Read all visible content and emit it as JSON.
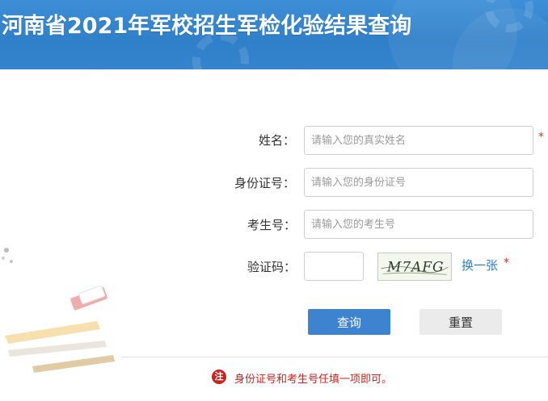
{
  "header": {
    "title": "河南省2021年军校招生军检化验结果查询"
  },
  "form": {
    "name": {
      "label": "姓名：",
      "placeholder": "请输入您的真实姓名",
      "required_mark": "*"
    },
    "id_number": {
      "label": "身份证号：",
      "placeholder": "请输入您的身份证号"
    },
    "exam_number": {
      "label": "考生号：",
      "placeholder": "请输入您的考生号"
    },
    "captcha": {
      "label": "验证码：",
      "value": "",
      "image_text": "M7AFG",
      "refresh_label": "换一张",
      "required_mark": "*"
    }
  },
  "actions": {
    "query_label": "查询",
    "reset_label": "重置"
  },
  "note": {
    "icon_text": "注",
    "text": "身份证号和考生号任填一项即可。"
  },
  "colors": {
    "banner": "#2f7fc9",
    "primary_button": "#3d83cf",
    "required": "#d9322f",
    "note": "#c8231f"
  }
}
